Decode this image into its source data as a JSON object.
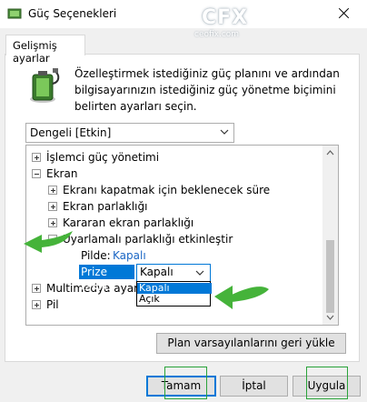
{
  "window": {
    "title": "Güç Seçenekleri"
  },
  "watermark": {
    "logo": "CFX",
    "site": "ceofix.com"
  },
  "tab": {
    "label": "Gelişmiş ayarlar"
  },
  "description": "Özelleştirmek istediğiniz güç planını ve ardından bilgisayarınızın istediğiniz güç yönetme biçimini belirten ayarları seçin.",
  "plan_select": {
    "value": "Dengeli [Etkin]"
  },
  "tree": {
    "processor": "İşlemci güç yönetimi",
    "screen": "Ekran",
    "screen_off": "Ekranı kapatmak için beklenecek süre",
    "brightness": "Ekran parlaklığı",
    "dim_brightness": "Kararan ekran parlaklığı",
    "adaptive": "Uyarlamalı parlaklığı etkinleştir",
    "battery_label": "Pilde:",
    "battery_value": "Kapalı",
    "plugged_label": "Prize takılı:",
    "multimedia": "Multimedya ayarla",
    "battery_node": "Pil"
  },
  "combo": {
    "value": "Kapalı",
    "options": [
      "Kapalı",
      "Açık"
    ],
    "selected_index": 0
  },
  "buttons": {
    "restore": "Plan varsayılanlarını geri yükle",
    "ok": "Tamam",
    "cancel": "İptal",
    "apply": "Uygula"
  },
  "colors": {
    "accent": "#0078d7",
    "link": "#1a66c4",
    "annotation_green": "#2aa33a"
  }
}
